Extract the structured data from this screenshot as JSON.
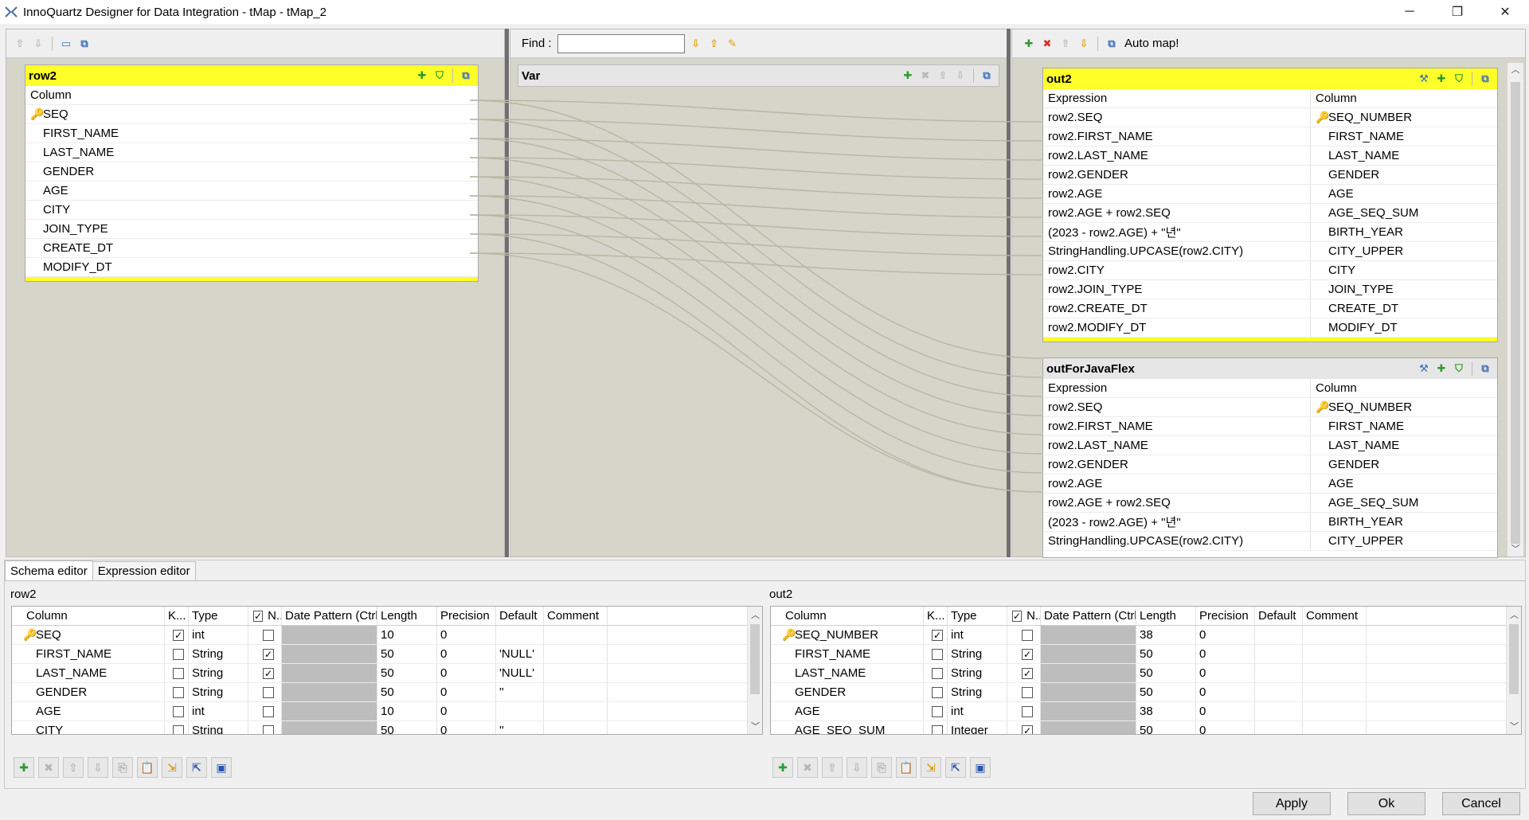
{
  "window": {
    "title": "InnoQuartz Designer for Data Integration - tMap - tMap_2",
    "buttons": [
      "─",
      "❐",
      "✕"
    ]
  },
  "find": {
    "label": "Find :",
    "value": ""
  },
  "auto_map_label": "Auto map!",
  "input_table": {
    "name": "row2",
    "column_header": "Column",
    "columns": [
      "SEQ",
      "FIRST_NAME",
      "LAST_NAME",
      "GENDER",
      "AGE",
      "CITY",
      "JOIN_TYPE",
      "CREATE_DT",
      "MODIFY_DT"
    ],
    "key_column": "SEQ"
  },
  "var_table": {
    "name": "Var"
  },
  "output_tables": [
    {
      "name": "out2",
      "expression_header": "Expression",
      "column_header": "Column",
      "rows": [
        {
          "expr": "row2.SEQ",
          "col": "SEQ_NUMBER",
          "key": true
        },
        {
          "expr": "row2.FIRST_NAME",
          "col": "FIRST_NAME"
        },
        {
          "expr": "row2.LAST_NAME",
          "col": "LAST_NAME"
        },
        {
          "expr": "row2.GENDER",
          "col": "GENDER"
        },
        {
          "expr": "row2.AGE",
          "col": "AGE"
        },
        {
          "expr": "row2.AGE + row2.SEQ",
          "col": "AGE_SEQ_SUM"
        },
        {
          "expr": "(2023 - row2.AGE) + \"년\"",
          "col": "BIRTH_YEAR"
        },
        {
          "expr": "StringHandling.UPCASE(row2.CITY)",
          "col": "CITY_UPPER"
        },
        {
          "expr": "row2.CITY",
          "col": "CITY"
        },
        {
          "expr": "row2.JOIN_TYPE",
          "col": "JOIN_TYPE"
        },
        {
          "expr": "row2.CREATE_DT",
          "col": "CREATE_DT"
        },
        {
          "expr": "row2.MODIFY_DT",
          "col": "MODIFY_DT"
        }
      ]
    },
    {
      "name": "outForJavaFlex",
      "expression_header": "Expression",
      "column_header": "Column",
      "rows": [
        {
          "expr": "row2.SEQ",
          "col": "SEQ_NUMBER",
          "key": true
        },
        {
          "expr": "row2.FIRST_NAME",
          "col": "FIRST_NAME"
        },
        {
          "expr": "row2.LAST_NAME",
          "col": "LAST_NAME"
        },
        {
          "expr": "row2.GENDER",
          "col": "GENDER"
        },
        {
          "expr": "row2.AGE",
          "col": "AGE"
        },
        {
          "expr": "row2.AGE + row2.SEQ",
          "col": "AGE_SEQ_SUM"
        },
        {
          "expr": "(2023 - row2.AGE) + \"년\"",
          "col": "BIRTH_YEAR"
        },
        {
          "expr": "StringHandling.UPCASE(row2.CITY)",
          "col": "CITY_UPPER"
        }
      ]
    }
  ],
  "editor": {
    "tabs": [
      "Schema editor",
      "Expression editor"
    ],
    "active_tab": "Schema editor",
    "headers": [
      "Column",
      "K...",
      "Type",
      "N...",
      "Date Pattern (Ctrl...",
      "Length",
      "Precision",
      "Default",
      "Comment"
    ],
    "left": {
      "label": "row2",
      "rows": [
        {
          "column": "SEQ",
          "key": true,
          "type": "int",
          "nullable": false,
          "length": "10",
          "precision": "0",
          "default": ""
        },
        {
          "column": "FIRST_NAME",
          "key": false,
          "type": "String",
          "nullable": true,
          "length": "50",
          "precision": "0",
          "default": "'NULL'"
        },
        {
          "column": "LAST_NAME",
          "key": false,
          "type": "String",
          "nullable": true,
          "length": "50",
          "precision": "0",
          "default": "'NULL'"
        },
        {
          "column": "GENDER",
          "key": false,
          "type": "String",
          "nullable": false,
          "length": "50",
          "precision": "0",
          "default": "''"
        },
        {
          "column": "AGE",
          "key": false,
          "type": "int",
          "nullable": false,
          "length": "10",
          "precision": "0",
          "default": ""
        },
        {
          "column": "CITY",
          "key": false,
          "type": "String",
          "nullable": false,
          "length": "50",
          "precision": "0",
          "default": "''"
        }
      ]
    },
    "right": {
      "label": "out2",
      "rows": [
        {
          "column": "SEQ_NUMBER",
          "key": true,
          "type": "int",
          "nullable": false,
          "length": "38",
          "precision": "0",
          "default": ""
        },
        {
          "column": "FIRST_NAME",
          "key": false,
          "type": "String",
          "nullable": true,
          "length": "50",
          "precision": "0",
          "default": ""
        },
        {
          "column": "LAST_NAME",
          "key": false,
          "type": "String",
          "nullable": true,
          "length": "50",
          "precision": "0",
          "default": ""
        },
        {
          "column": "GENDER",
          "key": false,
          "type": "String",
          "nullable": false,
          "length": "50",
          "precision": "0",
          "default": ""
        },
        {
          "column": "AGE",
          "key": false,
          "type": "int",
          "nullable": false,
          "length": "38",
          "precision": "0",
          "default": ""
        },
        {
          "column": "AGE_SEQ_SUM",
          "key": false,
          "type": "Integer",
          "nullable": true,
          "length": "50",
          "precision": "0",
          "default": ""
        }
      ]
    }
  },
  "dialog_buttons": {
    "apply": "Apply",
    "ok": "Ok",
    "cancel": "Cancel"
  },
  "colors": {
    "table_header": "#ffff29",
    "canvas": "#d6d5c9",
    "link": "#b8b6a4"
  }
}
